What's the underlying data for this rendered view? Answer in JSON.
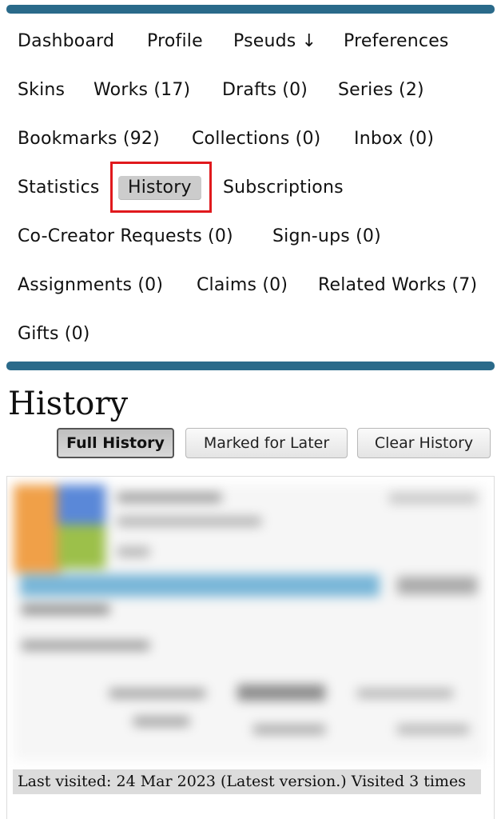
{
  "nav": {
    "rows": [
      [
        {
          "label": "Dashboard"
        },
        {
          "label": "Profile"
        },
        {
          "label": "Pseuds ↓"
        },
        {
          "label": "Preferences"
        }
      ],
      [
        {
          "label": "Skins"
        },
        {
          "label": "Works (17)"
        },
        {
          "label": "Drafts (0)"
        },
        {
          "label": "Series (2)"
        }
      ],
      [
        {
          "label": "Bookmarks (92)"
        },
        {
          "label": "Collections (0)"
        },
        {
          "label": "Inbox (0)"
        }
      ],
      [
        {
          "label": "Statistics"
        },
        {
          "label": "History",
          "current": true
        },
        {
          "label": "Subscriptions"
        }
      ],
      [
        {
          "label": "Co-Creator Requests (0)"
        },
        {
          "label": "Sign-ups (0)"
        }
      ],
      [
        {
          "label": "Assignments (0)"
        },
        {
          "label": "Claims (0)"
        },
        {
          "label": "Related Works (7)"
        }
      ],
      [
        {
          "label": "Gifts (0)"
        }
      ]
    ]
  },
  "page": {
    "title": "History"
  },
  "actions": {
    "full_history": "Full History",
    "marked_for_later": "Marked for Later",
    "clear_history": "Clear History"
  },
  "work": {
    "last_visited": "Last visited: 24 Mar 2023 (Latest version.) Visited 3 times"
  },
  "colors": {
    "bar": "#2a6a8a",
    "highlight": "#e0191d",
    "current_bg": "#cccccc"
  }
}
